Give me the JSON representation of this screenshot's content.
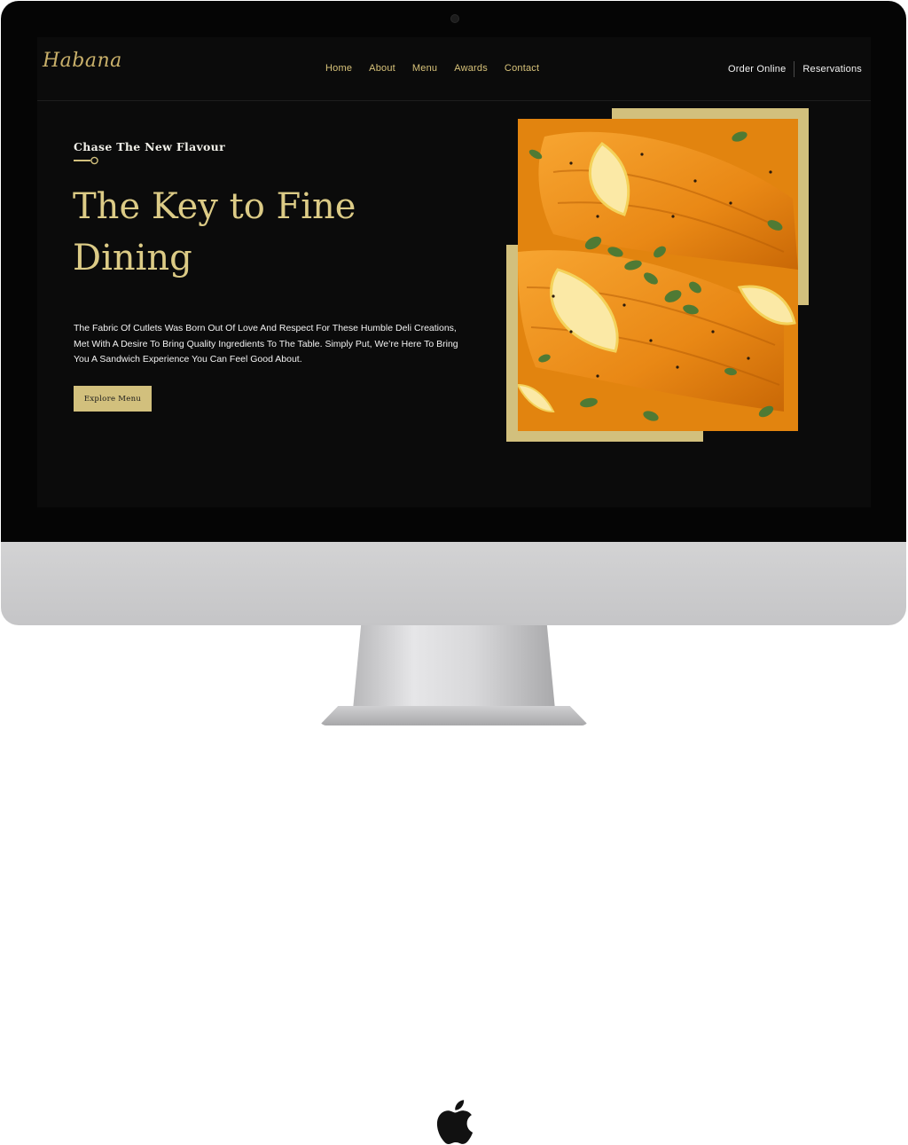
{
  "nav": {
    "logo": "Habana",
    "links": [
      "Home",
      "About",
      "Menu",
      "Awards",
      "Contact"
    ],
    "order_online": "Order Online",
    "reservations": "Reservations"
  },
  "hero": {
    "eyebrow": "Chase The New Flavour",
    "title_line1": "The Key to Fine",
    "title_line2": "Dining",
    "body": "The Fabric Of Cutlets Was Born Out Of Love And Respect For These Humble Deli Creations, Met With A Desire To Bring Quality Ingredients To The Table. Simply Put, We’re Here To Bring You A Sandwich Experience You Can Feel Good About.",
    "cta_label": "Explore Menu",
    "image_icon": "salmon-dish-photo"
  },
  "colors": {
    "gold": "#d2c07d",
    "title_gold": "#dccb86",
    "nav_gold": "#d8c37a",
    "screen_bg": "#0b0b0b"
  }
}
